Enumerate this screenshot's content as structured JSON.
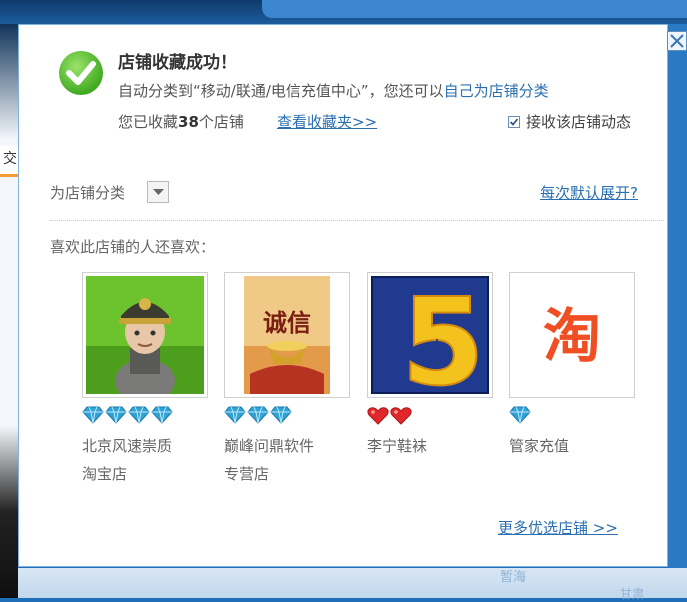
{
  "background": {
    "left_tab_text": "交",
    "bottom_text_1": "暂海",
    "bottom_text_2": "甘肃"
  },
  "dialog": {
    "title": "店铺收藏成功！",
    "line1_prefix": "自动分类到“移动/联通/电信充值中心”，您还可以",
    "line1_link": "自己为店铺分类",
    "line2_prefix": "您已收藏",
    "line2_count": "38",
    "line2_suffix": "个店铺",
    "view_favorites_link": "查看收藏夹>>",
    "receive_updates_label": "接收该店铺动态",
    "receive_updates_checked": true,
    "category_label": "为店铺分类",
    "expand_default_link": "每次默认展开?",
    "also_like_heading": "喜欢此店铺的人还喜欢：",
    "shops": [
      {
        "name_line1": "北京风速崇质",
        "name_line2": "淘宝店",
        "rank_icon": "diamond-icon",
        "rank_count": 4
      },
      {
        "name_line1": "巅峰问鼎软件",
        "name_line2": "专营店",
        "rank_icon": "diamond-icon",
        "rank_count": 3
      },
      {
        "name_line1": "李宁鞋袜",
        "name_line2": "",
        "rank_icon": "heart-icon",
        "rank_count": 2
      },
      {
        "name_line1": "管家充值",
        "name_line2": "",
        "rank_icon": "diamond-icon",
        "rank_count": 1
      }
    ],
    "shop_image_text": {
      "shop2_calligraphy": "诚信",
      "shop3_digit": "5",
      "shop4_char": "淘"
    },
    "more_shops_link": "更多优选店铺 >>"
  },
  "colors": {
    "link": "#2b6fb1",
    "success_green": "#5cc02f",
    "diamond": "#2fa3d6",
    "heart": "#e0272b"
  }
}
